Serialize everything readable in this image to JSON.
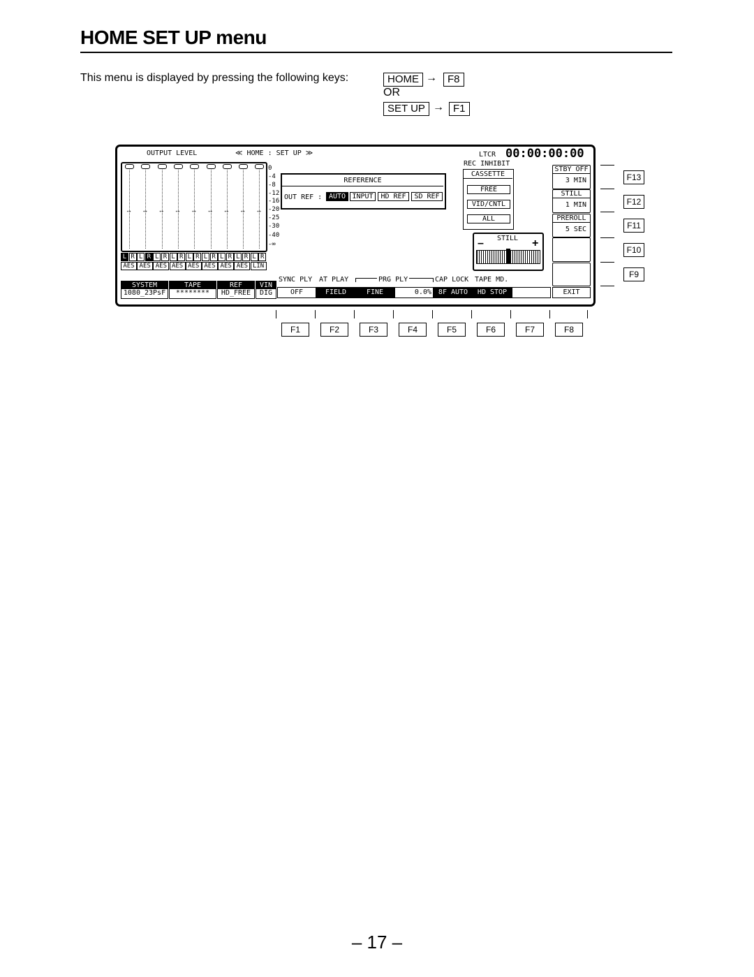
{
  "title": "HOME SET UP menu",
  "instruction": "This menu is displayed by pressing the following keys:",
  "keys1": [
    "HOME",
    "F8"
  ],
  "or": "OR",
  "keys2": [
    "SET UP",
    "F1"
  ],
  "arrow": "→",
  "screen": {
    "output_level": "OUTPUT LEVEL",
    "menu_title": "≪ HOME : SET UP ≫",
    "ltcr": "LTCR",
    "timecode": "00:00:00:00",
    "scale": [
      "0",
      "-4",
      "-8",
      "-12",
      "-16",
      "-20",
      "-25",
      "-30",
      "-40",
      "-∞"
    ],
    "channels_lr": [
      "L",
      "R",
      "L",
      "R",
      "L",
      "R",
      "L",
      "R",
      "L",
      "R",
      "L",
      "R",
      "L",
      "R",
      "L",
      "R",
      "L",
      "R"
    ],
    "channels_src": [
      "AES",
      "AES",
      "AES",
      "AES",
      "AES",
      "AES",
      "AES",
      "AES",
      "LIN"
    ],
    "reference": {
      "title": "REFERENCE",
      "label": "OUT REF :",
      "options": [
        "AUTO",
        "INPUT",
        "HD REF",
        "SD REF"
      ],
      "selected": "AUTO"
    },
    "rec_inhibit": "REC INHIBIT",
    "cassette": {
      "title": "CASSETTE",
      "options": [
        "FREE",
        "VID/CNTL",
        "ALL"
      ]
    },
    "still": {
      "title": "STILL",
      "minus": "–",
      "plus": "+"
    },
    "right_buttons": [
      {
        "label": "STBY OFF",
        "value": "3 MIN"
      },
      {
        "label": "STILL",
        "value": "1 MIN"
      },
      {
        "label": "PREROLL",
        "value": "5 SEC"
      },
      {
        "label": "",
        "value": ""
      },
      {
        "label": "",
        "value": ""
      }
    ],
    "status": [
      {
        "label": "SYSTEM",
        "value": "1080_23PsF"
      },
      {
        "label": "TAPE",
        "value": "********"
      },
      {
        "label": "REF",
        "value": "HD_FREE"
      },
      {
        "label": "VIN",
        "value": "DIG"
      }
    ],
    "softkey_labels": {
      "sync": "SYNC PLY",
      "at": "AT PLAY",
      "prg": "PRG PLY",
      "cap": "CAP LOCK",
      "tape": "TAPE MD."
    },
    "softkeys": [
      "OFF",
      "FIELD",
      "FINE",
      "0.0%",
      "8F AUTO",
      "HD STOP",
      "",
      "EXIT"
    ]
  },
  "side_keys": [
    "F13",
    "F12",
    "F11",
    "F10",
    "F9"
  ],
  "bottom_keys": [
    "F1",
    "F2",
    "F3",
    "F4",
    "F5",
    "F6",
    "F7",
    "F8"
  ],
  "page_number": "– 17 –"
}
